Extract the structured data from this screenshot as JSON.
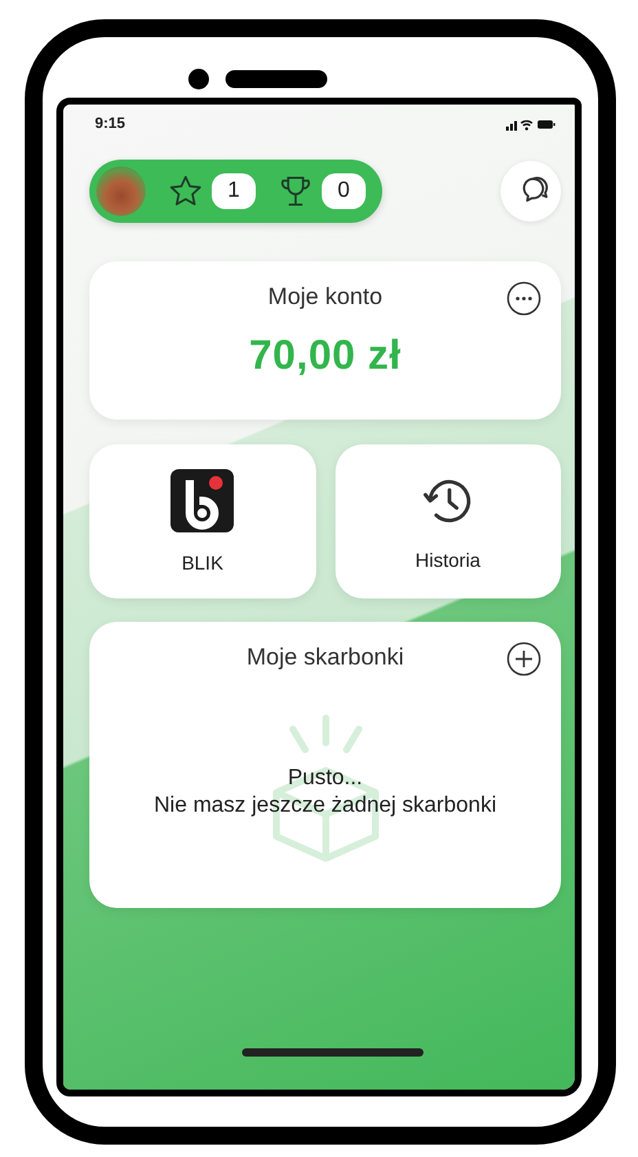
{
  "status_bar": {
    "time": "9:15"
  },
  "header": {
    "stats": [
      {
        "kind": "star",
        "count": "1"
      },
      {
        "kind": "trophy",
        "count": "0"
      }
    ]
  },
  "account": {
    "title": "Moje konto",
    "balance": "70,00 zł"
  },
  "shortcuts": [
    {
      "kind": "blik",
      "label": "BLIK"
    },
    {
      "kind": "history",
      "label": "Historia"
    }
  ],
  "piggy_banks": {
    "title": "Moje skarbonki",
    "empty_title": "Pusto...",
    "empty_message": "Nie masz jeszcze żadnej skarbonki"
  }
}
